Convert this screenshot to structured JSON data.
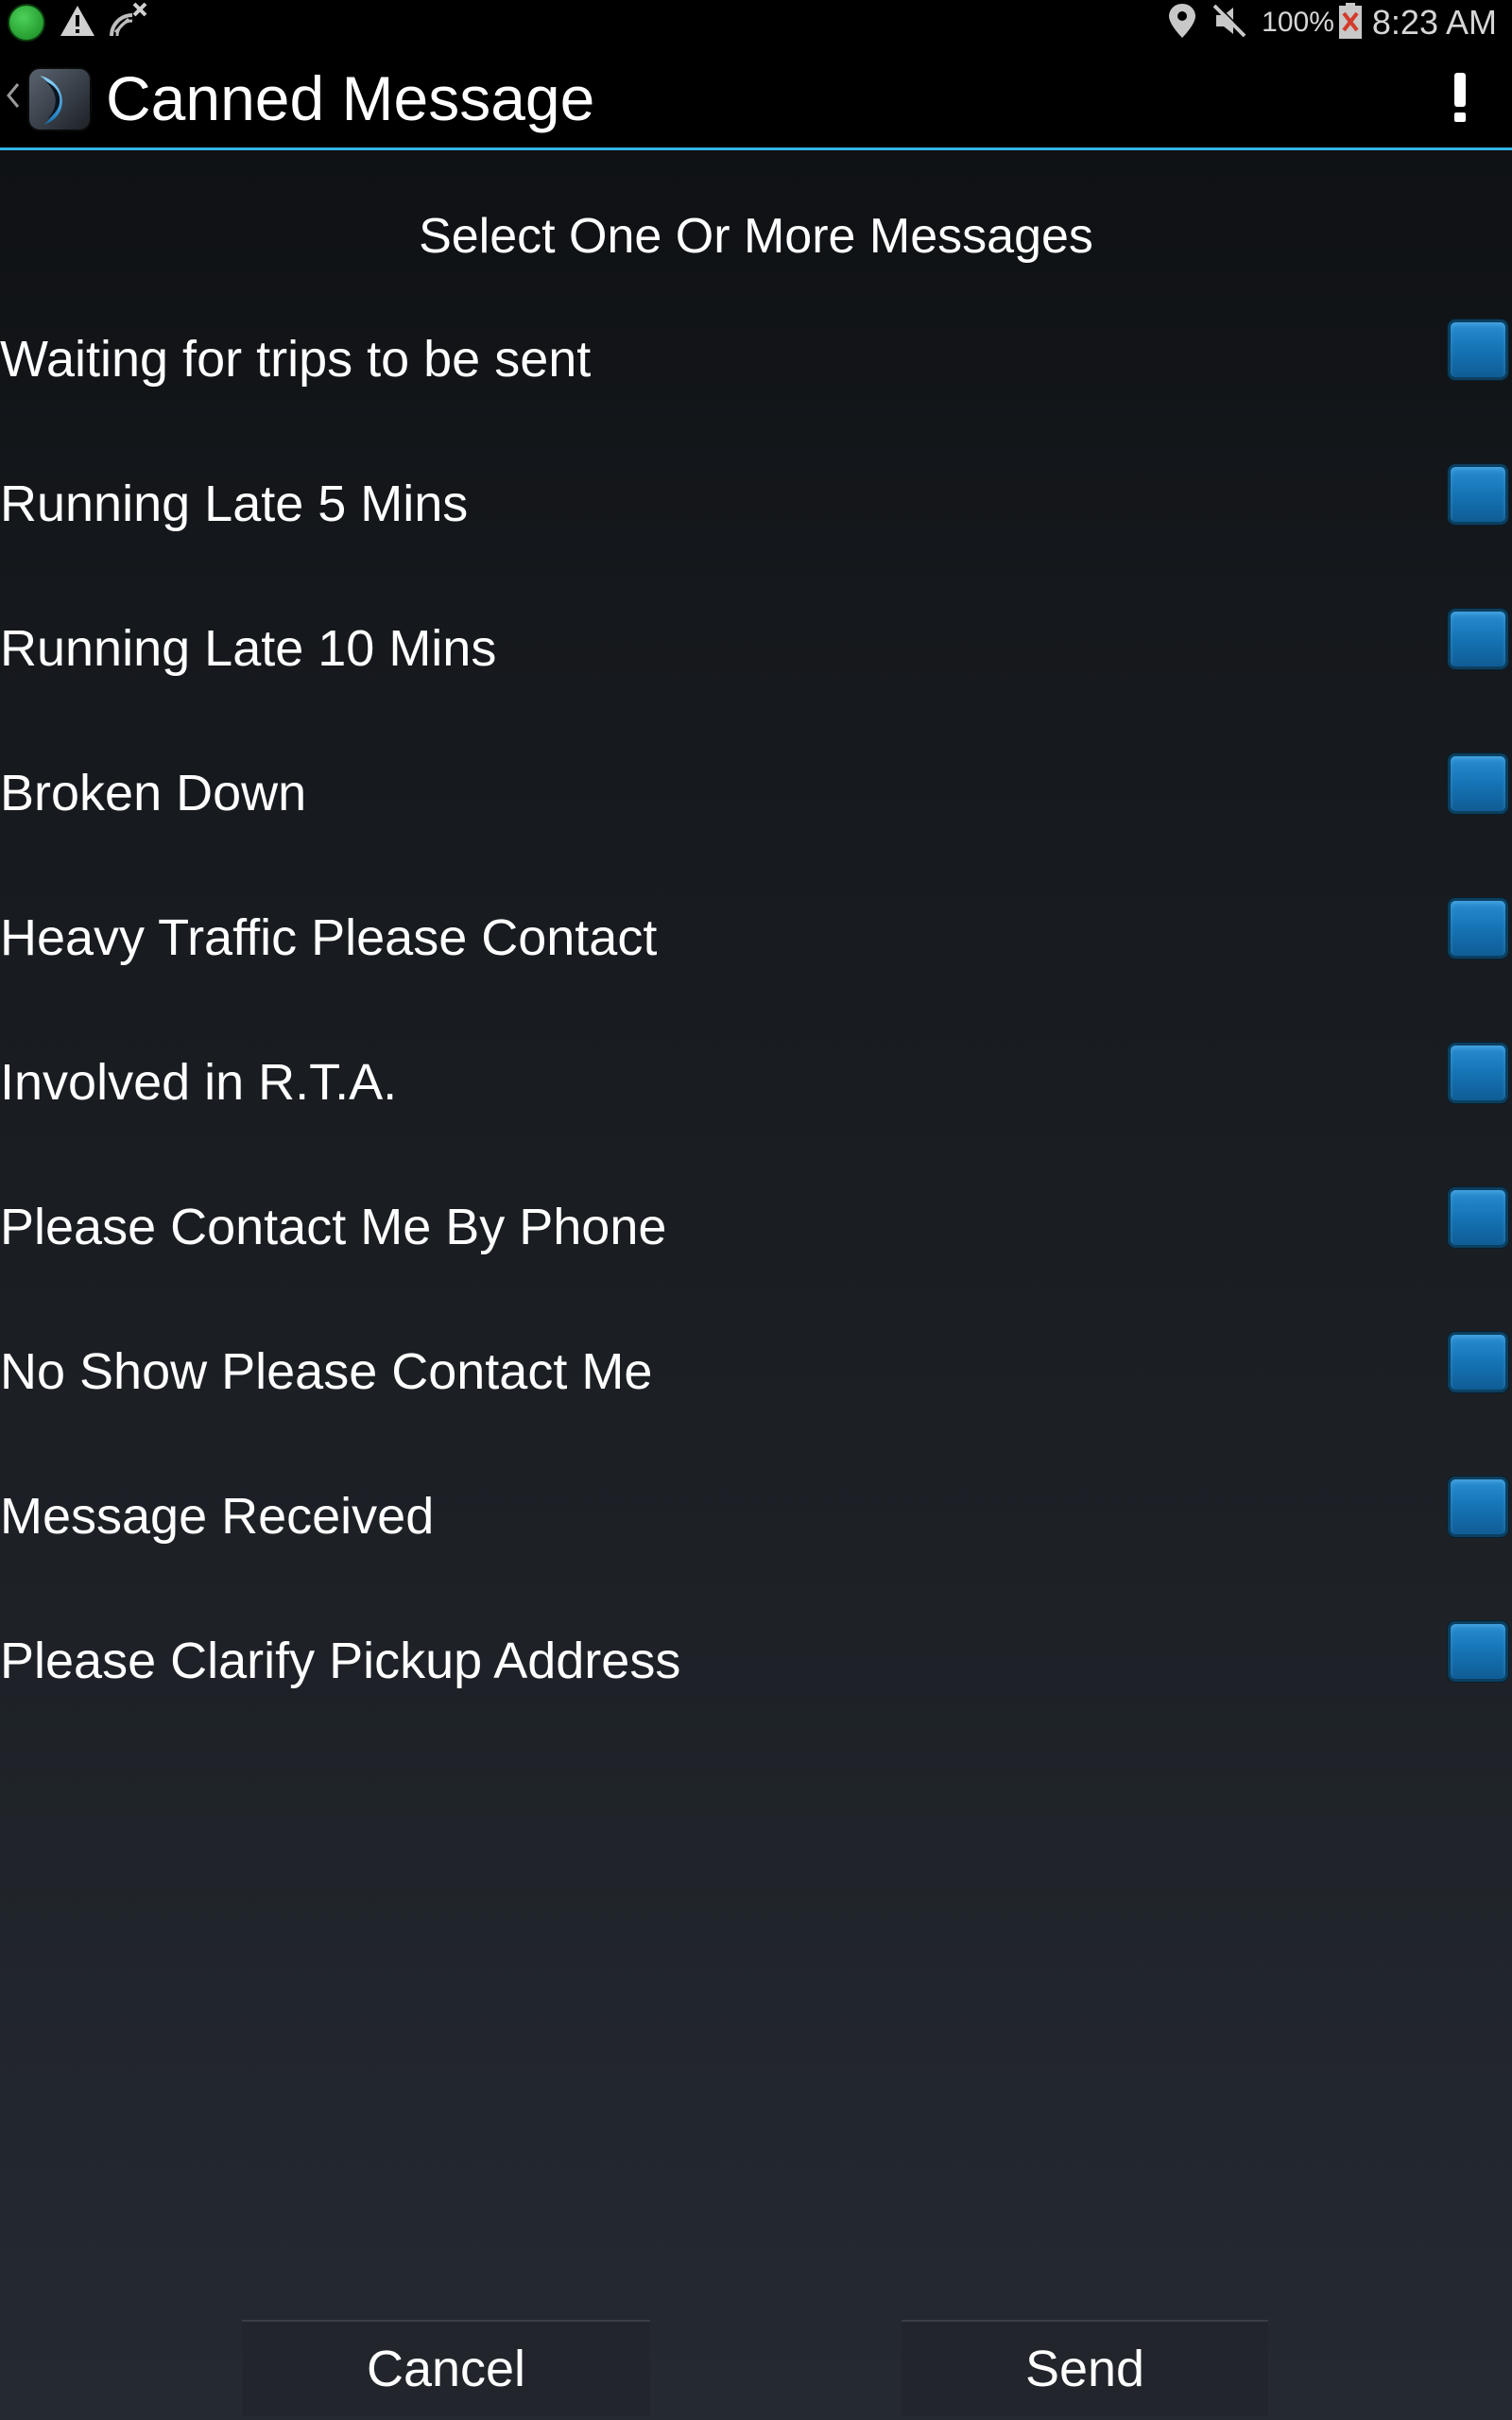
{
  "status_bar": {
    "battery": "100%",
    "time": "8:23 AM"
  },
  "action_bar": {
    "title": "Canned Message"
  },
  "heading": "Select One Or More Messages",
  "messages": [
    {
      "label": "Waiting for trips to be sent",
      "checked": false
    },
    {
      "label": "Running Late 5 Mins",
      "checked": false
    },
    {
      "label": "Running Late 10 Mins",
      "checked": false
    },
    {
      "label": "Broken Down",
      "checked": false
    },
    {
      "label": "Heavy Traffic Please Contact",
      "checked": false
    },
    {
      "label": "Involved in R.T.A.",
      "checked": false
    },
    {
      "label": "Please Contact Me By Phone",
      "checked": false
    },
    {
      "label": "No Show Please Contact Me",
      "checked": false
    },
    {
      "label": "Message Received",
      "checked": false
    },
    {
      "label": "Please Clarify Pickup Address",
      "checked": false
    }
  ],
  "buttons": {
    "cancel": "Cancel",
    "send": "Send"
  },
  "colors": {
    "accent": "#33b5e5",
    "checkbox": "#1676b8",
    "background_top": "#0d0f12",
    "background_bottom": "#252a31"
  },
  "icons": {
    "status_left": [
      "green-dot-icon",
      "warning-icon",
      "satellite-off-icon"
    ],
    "status_right": [
      "location-icon",
      "mute-icon",
      "battery-icon"
    ],
    "action_bar": [
      "up-chevron-icon",
      "app-logo-icon",
      "alert-exclamation-icon"
    ]
  }
}
